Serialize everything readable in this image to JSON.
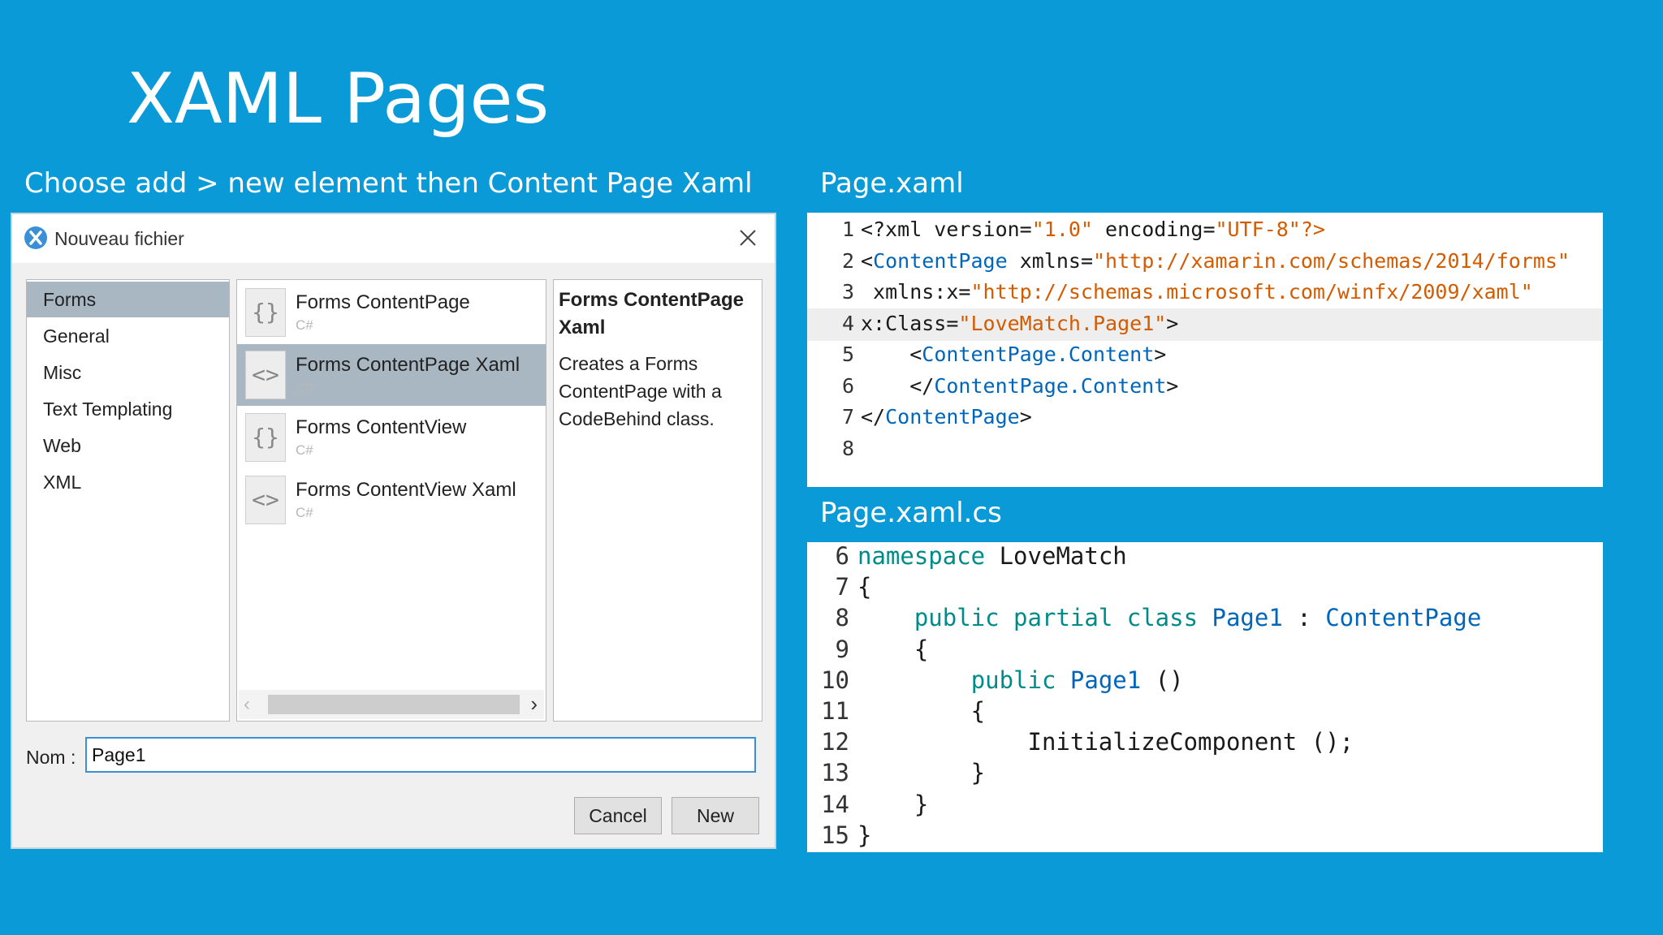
{
  "slide": {
    "title": "XAML Pages",
    "left_heading": "Choose add > new element then Content Page Xaml",
    "xaml_heading": "Page.xaml",
    "cs_heading": "Page.xaml.cs"
  },
  "dialog": {
    "title": "Nouveau fichier",
    "categories": [
      "Forms",
      "General",
      "Misc",
      "Text Templating",
      "Web",
      "XML"
    ],
    "selected_category": "Forms",
    "templates": [
      {
        "name": "Forms ContentPage",
        "lang": "C#",
        "icon": "braces-icon"
      },
      {
        "name": "Forms ContentPage Xaml",
        "lang": "C#",
        "icon": "angle-brackets-icon"
      },
      {
        "name": "Forms ContentView",
        "lang": "C#",
        "icon": "braces-icon"
      },
      {
        "name": "Forms ContentView Xaml",
        "lang": "C#",
        "icon": "angle-brackets-icon"
      }
    ],
    "selected_template": "Forms ContentPage Xaml",
    "description_title": "Forms ContentPage Xaml",
    "description_text": "Creates a Forms ContentPage with a CodeBehind class.",
    "name_label": "Nom :",
    "name_value": "Page1",
    "cancel_label": "Cancel",
    "new_label": "New"
  },
  "xaml_code": [
    {
      "n": "1",
      "parts": [
        [
          "t-bl",
          "<?xml version="
        ],
        [
          "t-val",
          "\"1.0\""
        ],
        [
          "t-bl",
          " encoding="
        ],
        [
          "t-val",
          "\"UTF-8\"?>"
        ]
      ]
    },
    {
      "n": "2",
      "parts": [
        [
          "t-bl",
          "<"
        ],
        [
          "t-kw",
          "ContentPage"
        ],
        [
          "t-bl",
          " xmlns="
        ],
        [
          "t-val",
          "\"http://xamarin.com/schemas/2014/forms\""
        ]
      ]
    },
    {
      "n": "3",
      "parts": [
        [
          "t-bl",
          " xmlns:x="
        ],
        [
          "t-val",
          "\"http://schemas.microsoft.com/winfx/2009/xaml\""
        ]
      ]
    },
    {
      "n": "4",
      "parts": [
        [
          "t-bl",
          "x:Class="
        ],
        [
          "t-val",
          "\"LoveMatch.Page1\""
        ],
        [
          "t-bl",
          ">"
        ]
      ]
    },
    {
      "n": "5",
      "parts": [
        [
          "t-bl",
          "    <"
        ],
        [
          "t-kw",
          "ContentPage.Content"
        ],
        [
          "t-bl",
          ">"
        ]
      ]
    },
    {
      "n": "6",
      "parts": [
        [
          "t-bl",
          "    </"
        ],
        [
          "t-kw",
          "ContentPage.Content"
        ],
        [
          "t-bl",
          ">"
        ]
      ]
    },
    {
      "n": "7",
      "parts": [
        [
          "t-bl",
          "</"
        ],
        [
          "t-kw",
          "ContentPage"
        ],
        [
          "t-bl",
          ">"
        ]
      ]
    },
    {
      "n": "8",
      "parts": []
    }
  ],
  "cs_code": [
    {
      "n": "6",
      "parts": [
        [
          "t-kw2",
          "namespace"
        ],
        [
          "t-bl",
          " LoveMatch"
        ]
      ]
    },
    {
      "n": "7",
      "parts": [
        [
          "t-bl",
          "{"
        ]
      ]
    },
    {
      "n": "8",
      "parts": [
        [
          "t-bl",
          "    "
        ],
        [
          "t-kw2",
          "public partial class"
        ],
        [
          "t-bl",
          " "
        ],
        [
          "t-kw",
          "Page1"
        ],
        [
          "t-bl",
          " : "
        ],
        [
          "t-kw",
          "ContentPage"
        ]
      ]
    },
    {
      "n": "9",
      "parts": [
        [
          "t-bl",
          "    {"
        ]
      ]
    },
    {
      "n": "10",
      "parts": [
        [
          "t-bl",
          "        "
        ],
        [
          "t-kw2",
          "public"
        ],
        [
          "t-bl",
          " "
        ],
        [
          "t-kw",
          "Page1"
        ],
        [
          "t-bl",
          " ()"
        ]
      ]
    },
    {
      "n": "11",
      "parts": [
        [
          "t-bl",
          "        {"
        ]
      ]
    },
    {
      "n": "12",
      "parts": [
        [
          "t-bl",
          "            InitializeComponent ();"
        ]
      ]
    },
    {
      "n": "13",
      "parts": [
        [
          "t-bl",
          "        }"
        ]
      ]
    },
    {
      "n": "14",
      "parts": [
        [
          "t-bl",
          "    }"
        ]
      ]
    },
    {
      "n": "15",
      "parts": [
        [
          "t-bl",
          "}"
        ]
      ]
    }
  ]
}
